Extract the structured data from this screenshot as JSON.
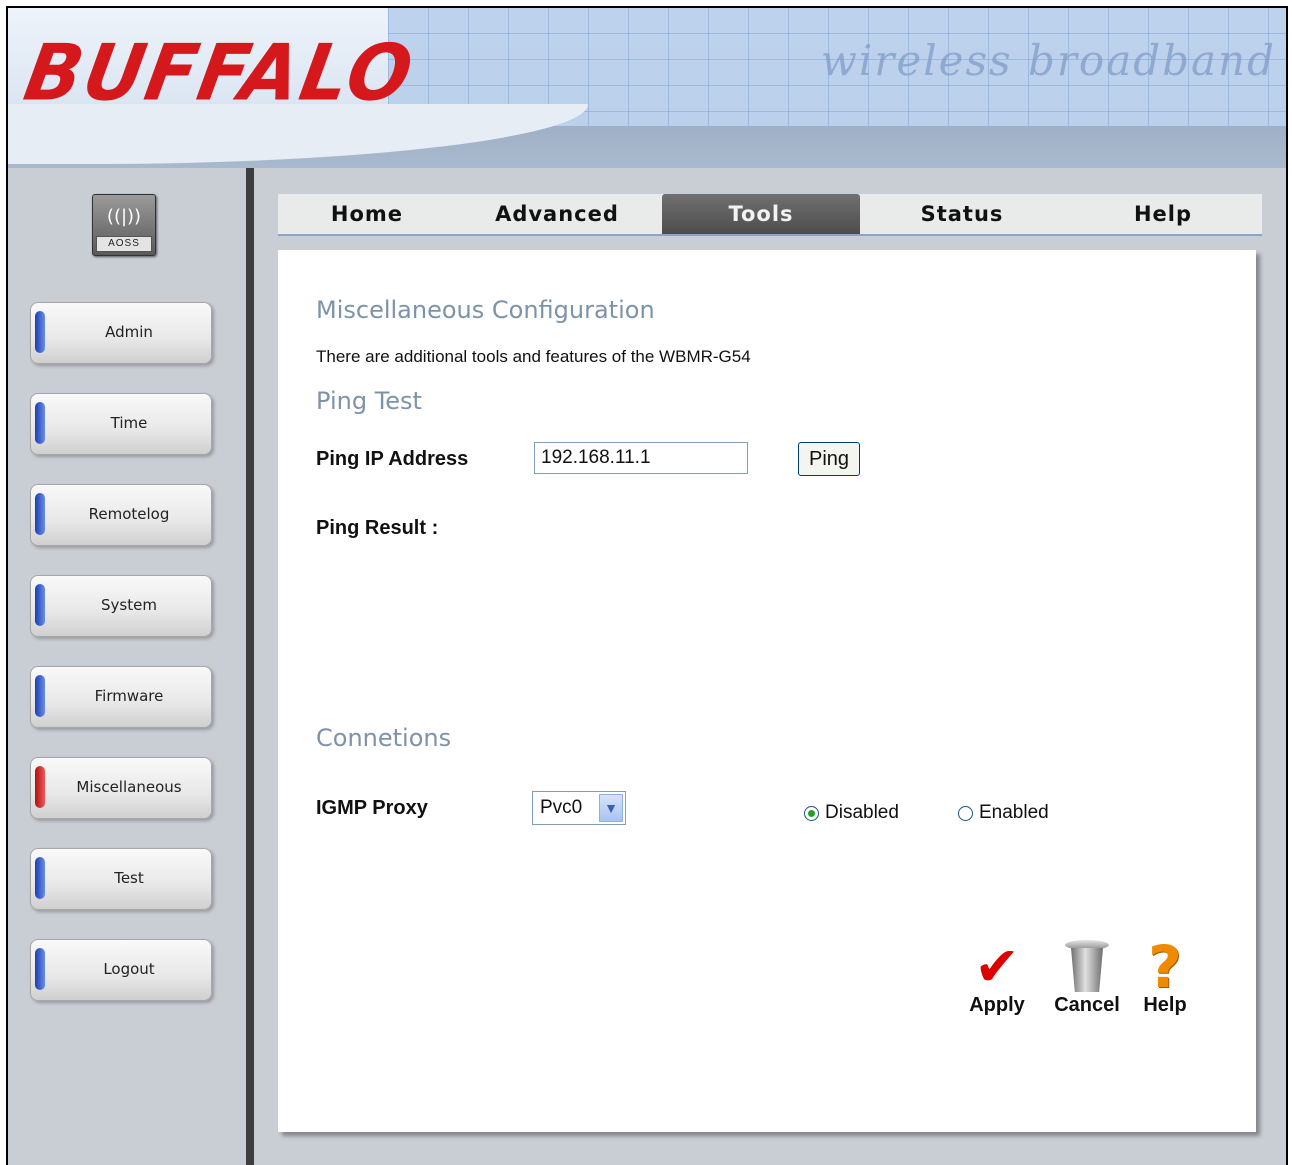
{
  "brand": {
    "logo_text": "BUFFALO",
    "header_script": "wireless broadband"
  },
  "aoss": {
    "label": "AOSS",
    "wave": "((|))"
  },
  "sidebar": {
    "items": [
      {
        "label": "Admin"
      },
      {
        "label": "Time"
      },
      {
        "label": "Remotelog"
      },
      {
        "label": "System"
      },
      {
        "label": "Firmware"
      },
      {
        "label": "Miscellaneous",
        "active": true
      },
      {
        "label": "Test"
      },
      {
        "label": "Logout"
      }
    ]
  },
  "tabs": [
    {
      "label": "Home"
    },
    {
      "label": "Advanced"
    },
    {
      "label": "Tools",
      "active": true
    },
    {
      "label": "Status"
    },
    {
      "label": "Help"
    }
  ],
  "main": {
    "title": "Miscellaneous Configuration",
    "description": "There are additional tools and features of the WBMR-G54",
    "ping": {
      "heading": "Ping Test",
      "ip_label": "Ping IP Address",
      "ip_value": "192.168.11.1",
      "button_label": "Ping",
      "result_label": "Ping Result :"
    },
    "connections": {
      "heading": "Connetions",
      "igmp_label": "IGMP Proxy",
      "select_value": "Pvc0",
      "radio_disabled": "Disabled",
      "radio_enabled": "Enabled",
      "selected": "Disabled"
    },
    "actions": {
      "apply": "Apply",
      "cancel": "Cancel",
      "help": "Help"
    }
  },
  "colors": {
    "brand_red": "#d4181c",
    "section_heading": "#7d93a8",
    "active_tab": "#555555"
  }
}
